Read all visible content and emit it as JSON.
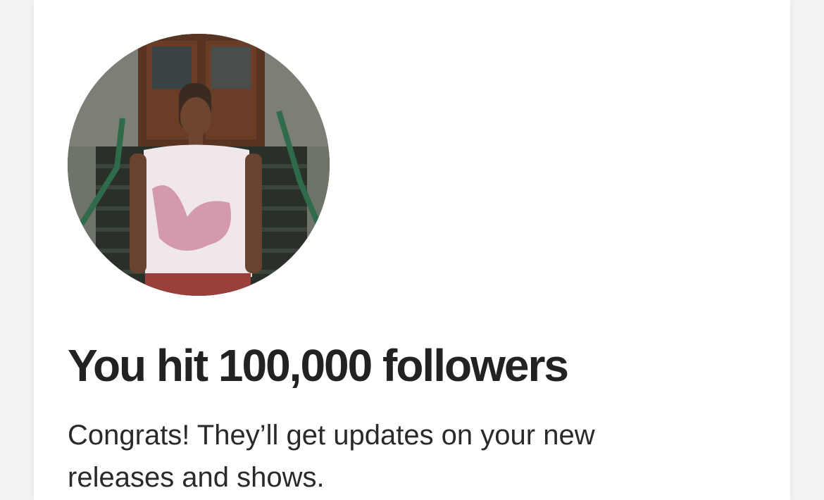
{
  "notification": {
    "avatar_icon": "artist-profile-photo",
    "title": "You hit 100,000 followers",
    "message": "Congrats! They’ll get updates on your new releases and shows."
  },
  "colors": {
    "background": "#ffffff",
    "title": "#222222",
    "text": "#2a2a2a"
  }
}
